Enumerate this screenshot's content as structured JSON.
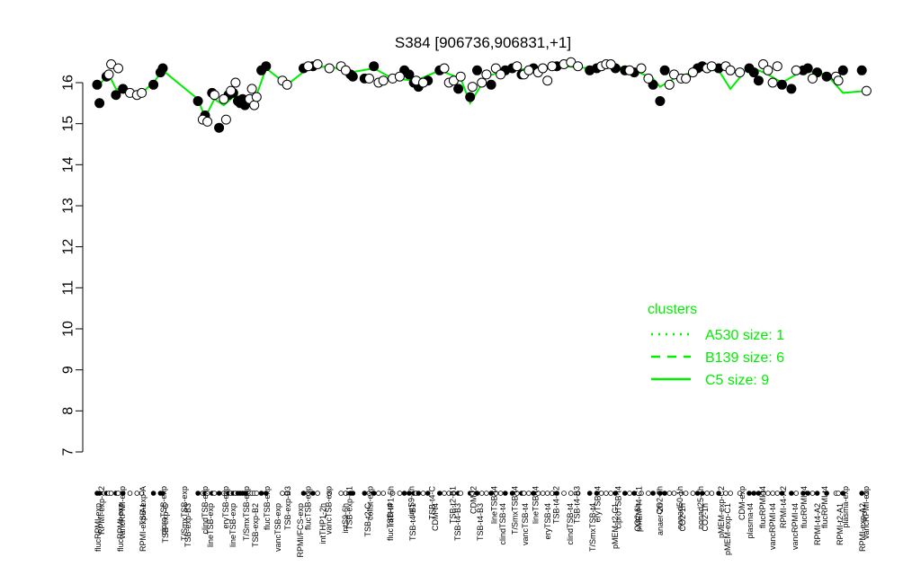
{
  "chart_data": {
    "type": "scatter",
    "title": "S384 [906736,906831,+1]",
    "xlabel": "",
    "ylabel": "",
    "ylim": [
      7,
      16.5
    ],
    "yticks": [
      7,
      8,
      9,
      10,
      11,
      12,
      13,
      14,
      15,
      16
    ],
    "grid": false,
    "categories_top": [
      "RPMI-exp-A2",
      "vancRPMI-exp",
      "TSB-exp-A",
      "ciproTSB-exp",
      "T/SmxTSB-exp",
      "clindTSB-exp",
      "eryTSB-exp",
      "T/SmxTSB-exp",
      "flucTSB-exp",
      "TSB-exp-B3",
      "flucTSB-exp",
      "vancTSB-exp",
      "TSB-exp-B1",
      "colist-exp",
      "intTHP1-6h",
      "intS9-2h",
      "TSB-t4-C",
      "TSB-t2-B1",
      "CDM-t2",
      "lineTSB-t4",
      "T/SmxTSB-t4",
      "lineTSB-t4",
      "TSB-t4-B2",
      "TSB-t4-B3",
      "eryTSB-t4",
      "ciproTSB-t4",
      "pMEM-t4-C1",
      "CO2-2h",
      "nonad50-1h",
      "nonad25-1h",
      "pMEM-exp-C2",
      "CDM-exp",
      "flucRPMI-t4",
      "RPMI-t4-A2",
      "flucRPMI-t4",
      "flucRPMI-t4",
      "plasma-exp",
      "vancRPMI-exp"
    ],
    "categories_bottom": [
      "flucRPMI-exp",
      "flucRPMI-exp",
      "RPMI-exp-A1",
      "TSB-exp-C",
      "TSB-exp-B3",
      "lineTSB-exp",
      "lineTSB-exp",
      "TSB-exp-B2",
      "vancTSB-exp",
      "RPMI/FCS-exp",
      "intTHP1-2h",
      "intS9-6h",
      "TSB-t2-C",
      "flucTSB-t4",
      "TSB-t4-B1",
      "CDM-t4",
      "TSB-t4-B3",
      "TSB-t4-B3",
      "clindTSB-t4",
      "vancTSB-t4",
      "eryTSB-t4",
      "clindTSB-t4",
      "T/SmxTSB-t4",
      "pMEM-t2-C1",
      "CO2-6h",
      "anaer-2h",
      "CO2-1h",
      "CO2-1h",
      "pMEM-exp-C1",
      "plasma-t4",
      "vancRPMI-t4",
      "vancRPMI-t4",
      "RPMI-t4-A2",
      "RPMI-t2-A1",
      "RPMI-exp-A2"
    ],
    "series": [
      {
        "name": "",
        "style": "filled",
        "points": [
          [
            0,
            15.95
          ],
          [
            1,
            15.5
          ],
          [
            4,
            16.15
          ],
          [
            8,
            15.7
          ],
          [
            11,
            15.85
          ],
          [
            24,
            15.95
          ],
          [
            27,
            16.25
          ],
          [
            28,
            16.35
          ],
          [
            43,
            15.55
          ],
          [
            46,
            15.2
          ],
          [
            49,
            15.75
          ],
          [
            52,
            14.9
          ],
          [
            56,
            15.7
          ],
          [
            58,
            15.75
          ],
          [
            60,
            15.55
          ],
          [
            61,
            15.5
          ],
          [
            62,
            15.6
          ],
          [
            63,
            15.45
          ],
          [
            64,
            15.55
          ],
          [
            70,
            16.3
          ],
          [
            72,
            16.4
          ],
          [
            88,
            16.35
          ],
          [
            92,
            16.4
          ],
          [
            108,
            16.2
          ],
          [
            109,
            16.15
          ],
          [
            114,
            16.1
          ],
          [
            118,
            16.4
          ],
          [
            131,
            16.3
          ],
          [
            133,
            16.2
          ],
          [
            135,
            16.0
          ],
          [
            137,
            15.9
          ],
          [
            141,
            16.05
          ],
          [
            146,
            16.3
          ],
          [
            154,
            15.85
          ],
          [
            159,
            15.65
          ],
          [
            162,
            16.3
          ],
          [
            168,
            15.95
          ],
          [
            174,
            16.3
          ],
          [
            177,
            16.35
          ],
          [
            181,
            16.2
          ],
          [
            186,
            16.35
          ],
          [
            196,
            16.4
          ],
          [
            210,
            16.3
          ],
          [
            213,
            16.35
          ],
          [
            221,
            16.35
          ],
          [
            225,
            16.3
          ],
          [
            229,
            16.25
          ],
          [
            237,
            15.95
          ],
          [
            240,
            15.55
          ],
          [
            242,
            16.3
          ],
          [
            256,
            16.35
          ],
          [
            258,
            16.4
          ],
          [
            265,
            16.35
          ],
          [
            278,
            16.35
          ],
          [
            280,
            16.25
          ],
          [
            282,
            16.05
          ],
          [
            292,
            15.95
          ],
          [
            296,
            15.85
          ],
          [
            301,
            16.3
          ],
          [
            303,
            16.35
          ],
          [
            307,
            16.25
          ],
          [
            311,
            16.15
          ],
          [
            318,
            16.3
          ],
          [
            326,
            16.3
          ]
        ]
      },
      {
        "name": "",
        "style": "open",
        "points": [
          [
            5,
            16.2
          ],
          [
            6,
            16.45
          ],
          [
            9,
            16.35
          ],
          [
            14,
            15.75
          ],
          [
            17,
            15.7
          ],
          [
            19,
            15.75
          ],
          [
            45,
            15.1
          ],
          [
            47,
            15.05
          ],
          [
            50,
            15.7
          ],
          [
            54,
            15.6
          ],
          [
            55,
            15.1
          ],
          [
            57,
            15.8
          ],
          [
            59,
            16.0
          ],
          [
            65,
            15.6
          ],
          [
            66,
            15.85
          ],
          [
            67,
            15.45
          ],
          [
            68,
            15.65
          ],
          [
            79,
            16.05
          ],
          [
            81,
            15.95
          ],
          [
            90,
            16.4
          ],
          [
            94,
            16.45
          ],
          [
            99,
            16.35
          ],
          [
            104,
            16.4
          ],
          [
            106,
            16.3
          ],
          [
            116,
            16.1
          ],
          [
            120,
            16.0
          ],
          [
            122,
            16.05
          ],
          [
            126,
            16.1
          ],
          [
            129,
            16.15
          ],
          [
            136,
            16.05
          ],
          [
            139,
            16.0
          ],
          [
            148,
            16.35
          ],
          [
            150,
            16.0
          ],
          [
            152,
            16.05
          ],
          [
            155,
            16.15
          ],
          [
            160,
            15.9
          ],
          [
            164,
            16.0
          ],
          [
            166,
            16.2
          ],
          [
            170,
            16.35
          ],
          [
            172,
            16.2
          ],
          [
            179,
            16.4
          ],
          [
            182,
            16.2
          ],
          [
            184,
            16.3
          ],
          [
            188,
            16.25
          ],
          [
            190,
            16.35
          ],
          [
            192,
            16.05
          ],
          [
            194,
            16.4
          ],
          [
            199,
            16.45
          ],
          [
            202,
            16.5
          ],
          [
            205,
            16.4
          ],
          [
            215,
            16.4
          ],
          [
            217,
            16.45
          ],
          [
            219,
            16.45
          ],
          [
            227,
            16.3
          ],
          [
            232,
            16.35
          ],
          [
            235,
            16.1
          ],
          [
            244,
            15.95
          ],
          [
            246,
            16.2
          ],
          [
            249,
            16.1
          ],
          [
            251,
            16.1
          ],
          [
            254,
            16.25
          ],
          [
            260,
            16.35
          ],
          [
            262,
            16.4
          ],
          [
            268,
            16.4
          ],
          [
            270,
            16.3
          ],
          [
            274,
            16.25
          ],
          [
            284,
            16.45
          ],
          [
            286,
            16.3
          ],
          [
            288,
            16.0
          ],
          [
            290,
            16.4
          ],
          [
            298,
            16.3
          ],
          [
            305,
            16.1
          ],
          [
            315,
            16.15
          ],
          [
            316,
            16.05
          ],
          [
            328,
            15.8
          ]
        ]
      }
    ],
    "legend": {
      "title": "clusters",
      "placement": "right",
      "entries": [
        {
          "label": "A530 size: 1",
          "style": "dotted"
        },
        {
          "label": "B139 size: 6",
          "style": "dashed"
        },
        {
          "label": "C5 size: 9",
          "style": "solid"
        }
      ],
      "color": "#00ee00"
    },
    "line_color": "#00ee00",
    "line_series": [
      [
        0,
        15.9
      ],
      [
        5,
        16.2
      ],
      [
        8,
        15.85
      ],
      [
        14,
        15.8
      ],
      [
        19,
        15.75
      ],
      [
        24,
        16.0
      ],
      [
        28,
        16.3
      ],
      [
        43,
        15.6
      ],
      [
        46,
        15.15
      ],
      [
        50,
        15.6
      ],
      [
        54,
        15.45
      ],
      [
        59,
        15.7
      ],
      [
        63,
        15.6
      ],
      [
        68,
        15.7
      ],
      [
        72,
        16.35
      ],
      [
        81,
        15.95
      ],
      [
        90,
        16.35
      ],
      [
        99,
        16.4
      ],
      [
        108,
        16.25
      ],
      [
        118,
        16.35
      ],
      [
        126,
        16.1
      ],
      [
        136,
        16.05
      ],
      [
        146,
        16.3
      ],
      [
        155,
        16.1
      ],
      [
        159,
        15.5
      ],
      [
        166,
        16.15
      ],
      [
        177,
        16.35
      ],
      [
        186,
        16.3
      ],
      [
        199,
        16.4
      ],
      [
        210,
        16.35
      ],
      [
        221,
        16.4
      ],
      [
        229,
        16.3
      ],
      [
        237,
        16.1
      ],
      [
        240,
        15.9
      ],
      [
        246,
        16.1
      ],
      [
        256,
        16.3
      ],
      [
        265,
        16.3
      ],
      [
        270,
        15.85
      ],
      [
        278,
        16.4
      ],
      [
        286,
        16.2
      ],
      [
        292,
        16.0
      ],
      [
        301,
        16.3
      ],
      [
        311,
        16.2
      ],
      [
        318,
        15.75
      ],
      [
        328,
        15.8
      ]
    ],
    "rug_counts": 330
  }
}
